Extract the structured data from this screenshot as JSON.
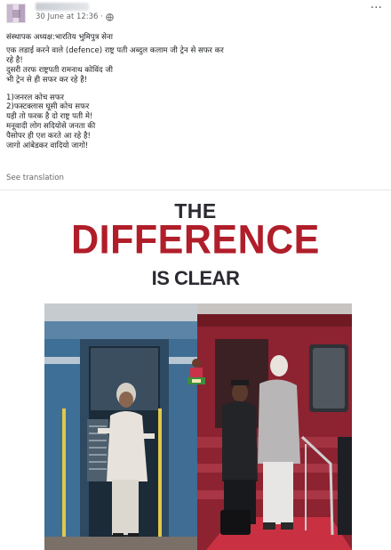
{
  "post": {
    "meta_date": "30 June at 12:36 ·",
    "see_translation": "See translation",
    "text_lines_1": [
      "संस्थापक अध्यक्ष:भारतिय भुमिपुत्र सेना"
    ],
    "text_lines_2": [
      "एक लडाई करने वाले (defence)  राष्ट्र पती अब्दुल कलाम जी ट्रेन से सफर कर",
      "रहे है!",
      "दुसरी तरफ राष्ट्रपती रामनाथ कोविंद जी",
      "भी ट्रेन से ही सफर कर रहे है!"
    ],
    "text_lines_3": [
      "1)जनरल कोच सफर",
      "2)फस्टक्लास घूसी कोच सफर",
      "यही तो फरक है दो राष्ट्र पती मे!",
      "मनूवादी लोग सदियोसे जनता की",
      "पैसोपर ही एश करते आ रहे है!",
      "जागो आंबेडकर वादियो जागो!"
    ]
  },
  "image": {
    "headline_the": "THE",
    "headline_difference": "DIFFERENCE",
    "headline_clear": "IS CLEAR"
  },
  "colors": {
    "headline_red": "#b01e2a",
    "headline_dark": "#2c2a31",
    "meta_gray": "#65676b"
  },
  "icons": {
    "privacy": "globe-icon",
    "options": "more-icon"
  }
}
